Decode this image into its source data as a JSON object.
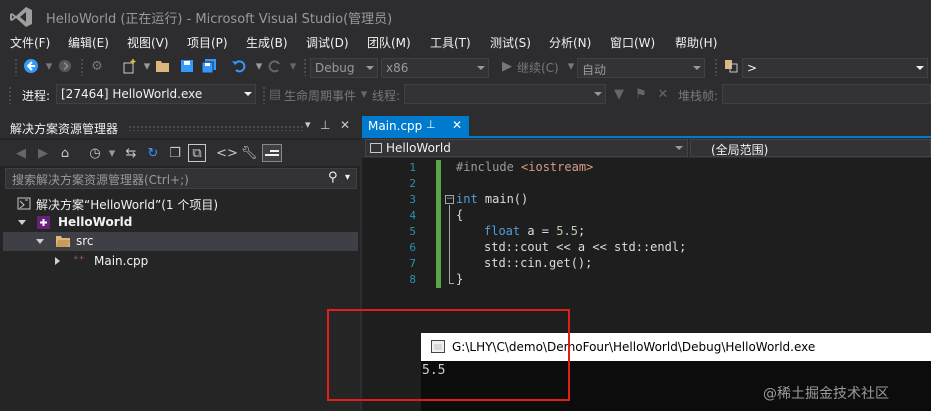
{
  "window": {
    "title": "HelloWorld (正在运行) - Microsoft Visual Studio(管理员)"
  },
  "menu": [
    {
      "label": "文件(F)"
    },
    {
      "label": "编辑(E)"
    },
    {
      "label": "视图(V)"
    },
    {
      "label": "项目(P)"
    },
    {
      "label": "生成(B)"
    },
    {
      "label": "调试(D)"
    },
    {
      "label": "团队(M)"
    },
    {
      "label": "工具(T)"
    },
    {
      "label": "测试(S)"
    },
    {
      "label": "分析(N)"
    },
    {
      "label": "窗口(W)"
    },
    {
      "label": "帮助(H)"
    }
  ],
  "toolbar": {
    "config": "Debug",
    "platform": "x86",
    "continue_label": "继续(C)",
    "auto": "自动",
    "target": ">"
  },
  "debug_bar": {
    "process_label": "进程:",
    "process_value": "[27464] HelloWorld.exe",
    "lifecycle_label": "生命周期事件",
    "thread_label": "线程:",
    "stack_label": "堆栈帧:"
  },
  "solution_explorer": {
    "title": "解决方案资源管理器",
    "search_placeholder": "搜索解决方案资源管理器(Ctrl+;)",
    "tree": {
      "solution": "解决方案“HelloWorld”(1 个项目)",
      "project": "HelloWorld",
      "folder": "src",
      "file": "Main.cpp"
    }
  },
  "editor": {
    "tab_label": "Main.cpp",
    "scope_left": "HelloWorld",
    "scope_right": "(全局范围)",
    "line_numbers": [
      "1",
      "2",
      "3",
      "4",
      "5",
      "6",
      "7",
      "8"
    ],
    "code": {
      "l1_directive": "#include",
      "l1_header": "<iostream>",
      "l3_type": "int",
      "l3_rest": " main()",
      "l4": "{",
      "l5_type": "float",
      "l5_rest": " a = ",
      "l5_num": "5.5",
      "l5_end": ";",
      "l6": "std::cout << a << std::endl;",
      "l7": "std::cin.get();",
      "l8": "}"
    }
  },
  "console": {
    "path": "G:\\LHY\\C\\demo\\DemoFour\\HelloWorld\\Debug\\HelloWorld.exe",
    "output": "5.5"
  },
  "watermark": "@稀土掘金技术社区",
  "colors": {
    "accent": "#007acc",
    "highlight_rect": "#e01e1e",
    "change_bar": "#57a64a"
  }
}
